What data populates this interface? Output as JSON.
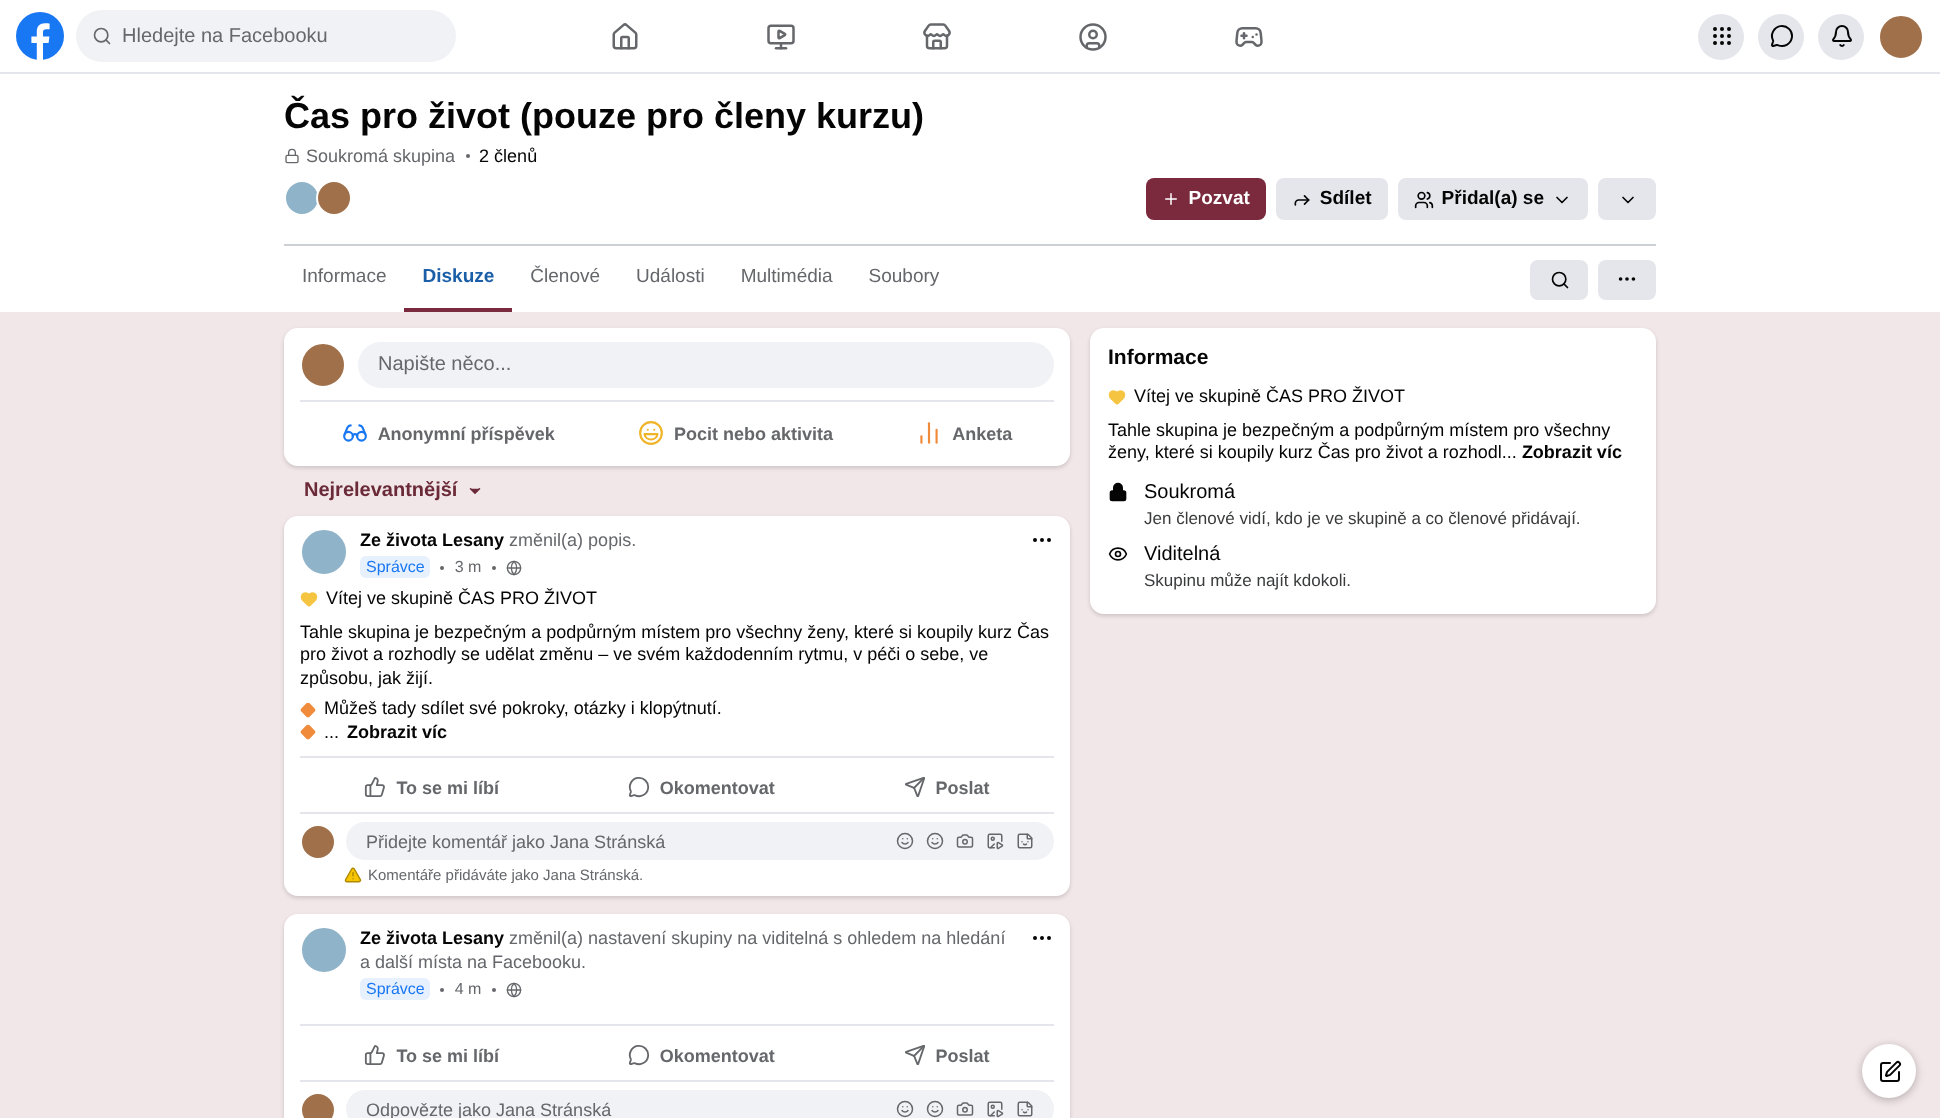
{
  "topbar": {
    "search_placeholder": "Hledejte na Facebooku"
  },
  "group": {
    "title": "Čas pro život (pouze pro členy kurzu)",
    "privacy": "Soukromá skupina",
    "members": "2 členů",
    "buttons": [
      {
        "kind": "invite",
        "label": "Pozvat"
      },
      {
        "kind": "share",
        "label": "Sdílet"
      },
      {
        "kind": "joined",
        "label": "Přidal(a) se"
      },
      {
        "kind": "expand"
      }
    ]
  },
  "tabs": [
    {
      "label": "Informace",
      "selected": false
    },
    {
      "label": "Diskuze",
      "selected": true
    },
    {
      "label": "Členové",
      "selected": false
    },
    {
      "label": "Události",
      "selected": false
    },
    {
      "label": "Multimédia",
      "selected": false
    },
    {
      "label": "Soubory",
      "selected": false
    }
  ],
  "composer": {
    "placeholder": "Napište něco...",
    "actions": [
      {
        "kind": "anonymous",
        "label": "Anonymní příspěvek"
      },
      {
        "kind": "feeling",
        "label": "Pocit nebo aktivita"
      },
      {
        "kind": "poll",
        "label": "Anketa"
      }
    ]
  },
  "sort": "Nejrelevantnější",
  "posts": [
    {
      "author": "Ze života Lesany",
      "action": "změnil(a) popis.",
      "badge": "Správce",
      "time": "3 m",
      "heading": "Vítej ve skupině ČAS PRO ŽIVOT",
      "body": "Tahle skupina je bezpečným a podpůrným místem pro všechny ženy, které si koupily kurz Čas pro život a rozhodly se udělat změnu – ve svém každodenním rytmu, v péči o sebe, ve způsobu, jak žijí.",
      "bullets": [
        "Můžeš tady sdílet své pokroky, otázky i klopýtnutí.",
        "..."
      ],
      "more": "Zobrazit víc",
      "actions": [
        "To se mi líbí",
        "Okomentovat",
        "Poslat"
      ],
      "comment_placeholder": "Přidejte komentář jako Jana Stránská",
      "note": "Komentáře přidáváte jako Jana Stránská."
    },
    {
      "author": "Ze života Lesany",
      "action": "změnil(a) nastavení skupiny na viditelná s ohledem na hledání a další místa na Facebooku.",
      "badge": "Správce",
      "time": "4 m",
      "actions": [
        "To se mi líbí",
        "Okomentovat",
        "Poslat"
      ],
      "comment_placeholder": "Odpovězte jako Jana Stránská"
    }
  ],
  "about": {
    "title": "Informace",
    "heading": "Vítej ve skupině ČAS PRO ŽIVOT",
    "text": "Tahle skupina je bezpečným a podpůrným místem pro všechny ženy, které si koupily kurz Čas pro život a rozhodl...",
    "more": "Zobrazit víc",
    "items": [
      {
        "kind": "private",
        "title": "Soukromá",
        "desc": "Jen členové vidí, kdo je ve skupině a co členové přidávají."
      },
      {
        "kind": "visible",
        "title": "Viditelná",
        "desc": "Skupinu může najít kdokoli."
      }
    ]
  }
}
